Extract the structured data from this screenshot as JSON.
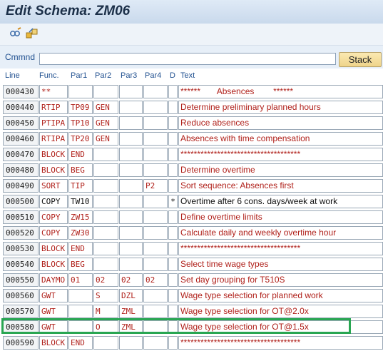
{
  "window": {
    "title": "Edit Schema: ZM06"
  },
  "toolbar": {
    "buttons": [
      "display-change-icon",
      "other-object-icon"
    ]
  },
  "command": {
    "label": "Cmmnd",
    "value": "",
    "stack_label": "Stack"
  },
  "columns": {
    "line": "Line",
    "func": "Func.",
    "par1": "Par1",
    "par2": "Par2",
    "par3": "Par3",
    "par4": "Par4",
    "d": "D",
    "text": "Text"
  },
  "rows": [
    {
      "line": "000430",
      "func": "**",
      "par1": "",
      "par2": "",
      "par3": "",
      "par4": "",
      "d": "",
      "text": "******       Absences        ******"
    },
    {
      "line": "000440",
      "func": "RTIP",
      "par1": "TP09",
      "par2": "GEN",
      "par3": "",
      "par4": "",
      "d": "",
      "text": "Determine preliminary planned hours"
    },
    {
      "line": "000450",
      "func": "PTIPA",
      "par1": "TP10",
      "par2": "GEN",
      "par3": "",
      "par4": "",
      "d": "",
      "text": "Reduce absences"
    },
    {
      "line": "000460",
      "func": "RTIPA",
      "par1": "TP20",
      "par2": "GEN",
      "par3": "",
      "par4": "",
      "d": "",
      "text": "Absences with time compensation"
    },
    {
      "line": "000470",
      "func": "BLOCK",
      "par1": "END",
      "par2": "",
      "par3": "",
      "par4": "",
      "d": "",
      "text": "************************************"
    },
    {
      "line": "000480",
      "func": "BLOCK",
      "par1": "BEG",
      "par2": "",
      "par3": "",
      "par4": "",
      "d": "",
      "text": "Determine overtime"
    },
    {
      "line": "000490",
      "func": "SORT",
      "par1": "TIP",
      "par2": "",
      "par3": "",
      "par4": "P2",
      "d": "",
      "text": "Sort sequence: Absences first"
    },
    {
      "line": "000500",
      "func": "COPY",
      "par1": "TW10",
      "par2": "",
      "par3": "",
      "par4": "",
      "d": "*",
      "text": "Overtime after 6 cons. days/week at work"
    },
    {
      "line": "000510",
      "func": "COPY",
      "par1": "ZW15",
      "par2": "",
      "par3": "",
      "par4": "",
      "d": "",
      "text": "Define overtime limits"
    },
    {
      "line": "000520",
      "func": "COPY",
      "par1": "ZW30",
      "par2": "",
      "par3": "",
      "par4": "",
      "d": "",
      "text": "Calculate daily and weekly overtime hour"
    },
    {
      "line": "000530",
      "func": "BLOCK",
      "par1": "END",
      "par2": "",
      "par3": "",
      "par4": "",
      "d": "",
      "text": "************************************"
    },
    {
      "line": "000540",
      "func": "BLOCK",
      "par1": "BEG",
      "par2": "",
      "par3": "",
      "par4": "",
      "d": "",
      "text": "Select time wage types"
    },
    {
      "line": "000550",
      "func": "DAYMO",
      "par1": "01",
      "par2": "02",
      "par3": "02",
      "par4": "02",
      "d": "",
      "text": "Set day grouping for T510S"
    },
    {
      "line": "000560",
      "func": "GWT",
      "par1": "",
      "par2": "S",
      "par3": "DZL",
      "par4": "",
      "d": "",
      "text": "Wage type selection for planned work"
    },
    {
      "line": "000570",
      "func": "GWT",
      "par1": "",
      "par2": "M",
      "par3": "ZML",
      "par4": "",
      "d": "",
      "text": "Wage type selection for OT@2.0x"
    },
    {
      "line": "000580",
      "func": "GWT",
      "par1": "",
      "par2": "O",
      "par3": "ZML",
      "par4": "",
      "d": "",
      "text": "Wage type selection for OT@1.5x"
    },
    {
      "line": "000590",
      "func": "BLOCK",
      "par1": "END",
      "par2": "",
      "par3": "",
      "par4": "",
      "d": "",
      "text": "************************************"
    }
  ],
  "colors": {
    "accent_text": "#b0211b",
    "label_blue": "#1f4f8f",
    "highlight": "#29a652"
  }
}
